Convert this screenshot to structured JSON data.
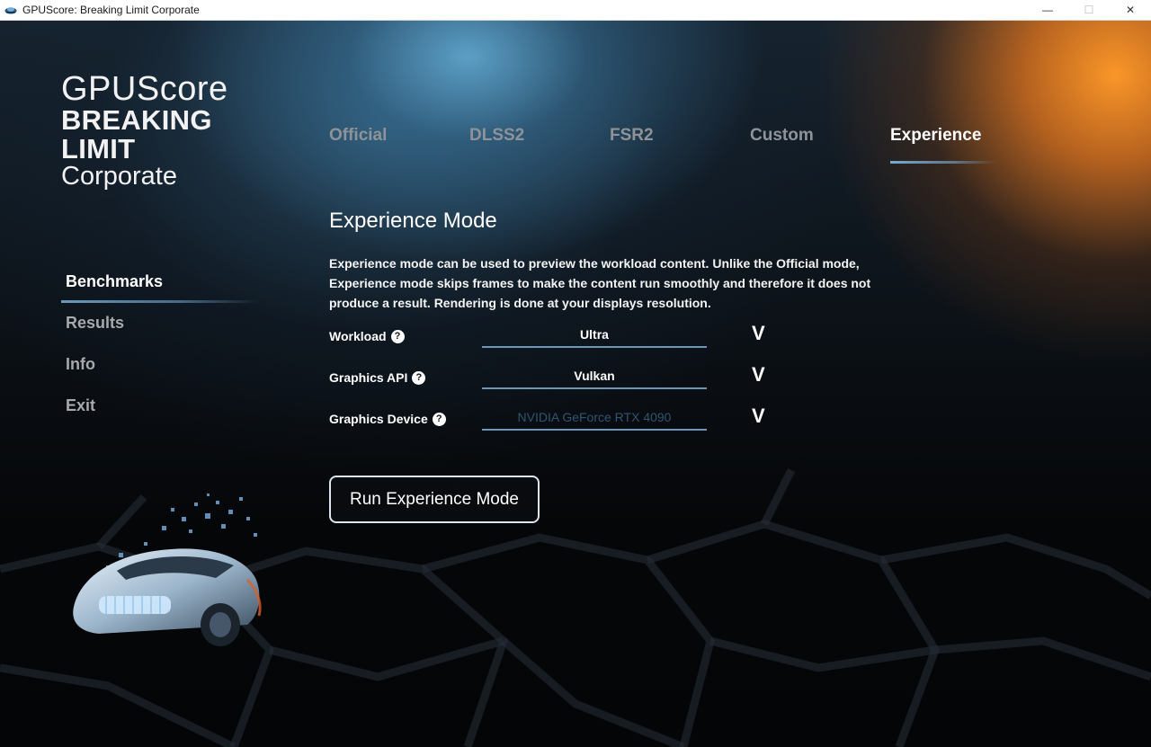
{
  "window": {
    "title": "GPUScore: Breaking Limit Corporate",
    "minimize_icon": "minimize-icon",
    "maximize_icon": "maximize-icon",
    "close_icon": "close-icon",
    "minimize_glyph": "—",
    "maximize_glyph": "☐",
    "close_glyph": "✕"
  },
  "logo": {
    "line1": "GPUScore",
    "line2": "BREAKING",
    "line3": "LIMIT",
    "line4": "Corporate"
  },
  "sidebar": {
    "items": [
      {
        "label": "Benchmarks",
        "active": true
      },
      {
        "label": "Results",
        "active": false
      },
      {
        "label": "Info",
        "active": false
      },
      {
        "label": "Exit",
        "active": false
      }
    ]
  },
  "tabs": [
    {
      "label": "Official",
      "active": false
    },
    {
      "label": "DLSS2",
      "active": false
    },
    {
      "label": "FSR2",
      "active": false
    },
    {
      "label": "Custom",
      "active": false
    },
    {
      "label": "Experience",
      "active": true
    }
  ],
  "main": {
    "heading": "Experience Mode",
    "description": "Experience mode can be used to preview the workload content. Unlike the Official mode, Experience mode skips frames to make the content run smoothly and therefore it does not produce a result. Rendering is done at your displays resolution.",
    "settings": [
      {
        "label": "Workload",
        "help": "?",
        "value": "Ultra",
        "chevron": "V",
        "enabled": true
      },
      {
        "label": "Graphics API",
        "help": "?",
        "value": "Vulkan",
        "chevron": "V",
        "enabled": true
      },
      {
        "label": "Graphics Device",
        "help": "?",
        "value": "NVIDIA GeForce RTX 4090",
        "chevron": "V",
        "enabled": false
      }
    ],
    "run_button": "Run Experience Mode"
  },
  "colors": {
    "accent_blue": "#78aad2",
    "accent_orange": "#fa9628",
    "background": "#06080b"
  }
}
